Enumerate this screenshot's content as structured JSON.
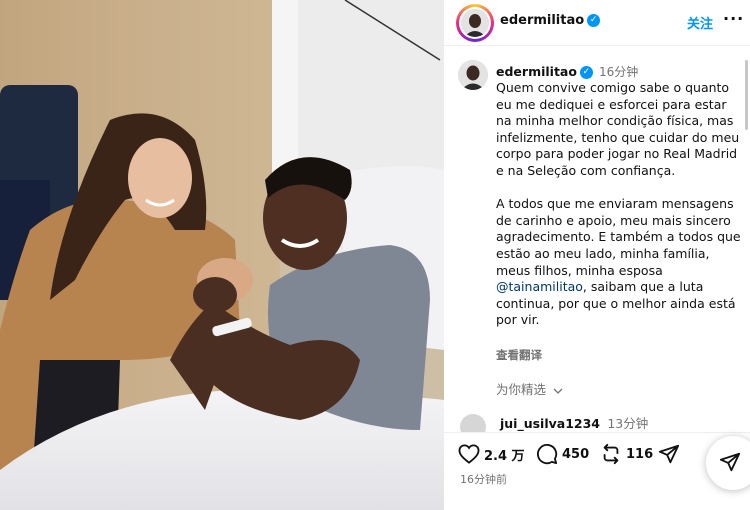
{
  "post": {
    "username": "edermilitao",
    "follow_label": "关注",
    "more_icon": "more-horizontal-icon",
    "verified_icon": "verified-badge-icon"
  },
  "caption": {
    "username": "edermilitao",
    "time": "16分钟",
    "paragraph1": "Quem convive comigo sabe o quanto eu me dediquei e esforcei para estar na minha melhor condição física, mas infelizmente, tenho que cuidar do meu corpo para poder jogar no Real Madrid e na Seleção com confiança.",
    "paragraph2_before": "A todos que me enviaram mensagens de carinho e apoio, meu mais sincero agradecimento. E também a todos que estão ao meu lado, minha família, meus filhos, minha esposa ",
    "mention": "@tainamilitao",
    "paragraph2_after": ", saibam que a luta continua, por que o melhor ainda está por vir.",
    "translate_label": "查看翻译"
  },
  "selected_label": "为你精选",
  "comment": {
    "username": "jui_usilva1234",
    "time": "13分钟"
  },
  "actions": {
    "likes": "2.4 万",
    "comments": "450",
    "reposts": "116",
    "timestamp": "16分钟前"
  },
  "colors": {
    "accent": "#0095f6",
    "mention": "#00376b",
    "muted": "#737373"
  }
}
